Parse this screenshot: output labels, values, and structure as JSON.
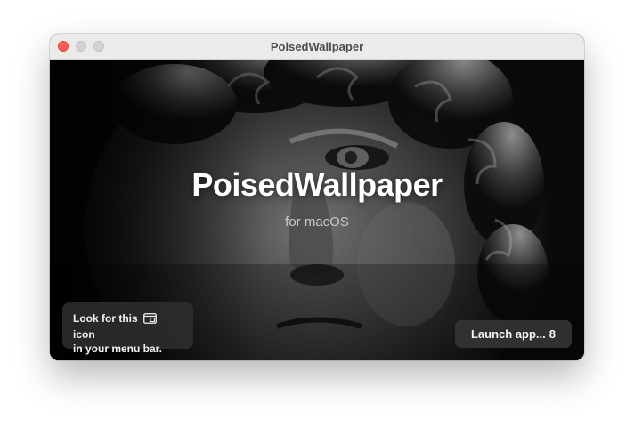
{
  "window": {
    "title": "PoisedWallpaper"
  },
  "hero": {
    "app_name": "PoisedWallpaper",
    "platform": "for macOS"
  },
  "hint": {
    "line1_before": "Look for this",
    "line1_after": "icon",
    "line2": "in your menu bar.",
    "icon": "menu-bar-window-icon"
  },
  "launch": {
    "label": "Launch app...",
    "countdown": "8"
  },
  "colors": {
    "close": "#fe5f57",
    "titlebar": "#ecebea",
    "badge_bg": "#2d2d2d"
  }
}
